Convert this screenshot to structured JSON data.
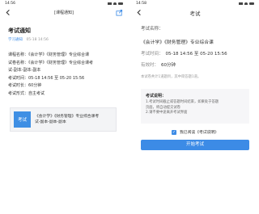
{
  "left": {
    "status": {
      "time": "14:56"
    },
    "nav": {
      "title": "[课程通知]"
    },
    "notice": {
      "title": "考试通知",
      "source": "学习通知",
      "datetime": "05-18 14:56",
      "lines": [
        "课程名称：《会计学》《财务管理》专业综合课",
        "试卷名称：《会计学》《财务管理》专业综合课考",
        "试-副本-副本-副本",
        "考试时间：05-18 14:56 至 05-20 15:56",
        "考试时长：60分钟",
        "考试形式：自主考试"
      ]
    },
    "card": {
      "badge": "考试",
      "text_line1": "《会计学》《财务管理》专业综合课考",
      "text_line2": "试-副本-副本-副本"
    }
  },
  "right": {
    "status": {
      "time": "14:58"
    },
    "nav": {
      "title": "考试"
    },
    "label": "考试名称：",
    "course": "《会计学》《财务管理》专业综合课",
    "time_label": "考试时间：",
    "time_value": "05-18 14:56 至 05-20 15:56",
    "duration_label": "有效时：",
    "duration_value": "60分钟",
    "hint": "本试卷共计1道题目，其中简答题1道。",
    "box": {
      "title": "考试说明：",
      "line1": "1.考试时间截止或答题时间结束，如果处于答题",
      "line2": "页面，将自动提交试卷",
      "line3": "2.请不要中途离开考试界面"
    },
    "agree": "我已阅读《考试说明》",
    "start_button": "开始考试"
  }
}
